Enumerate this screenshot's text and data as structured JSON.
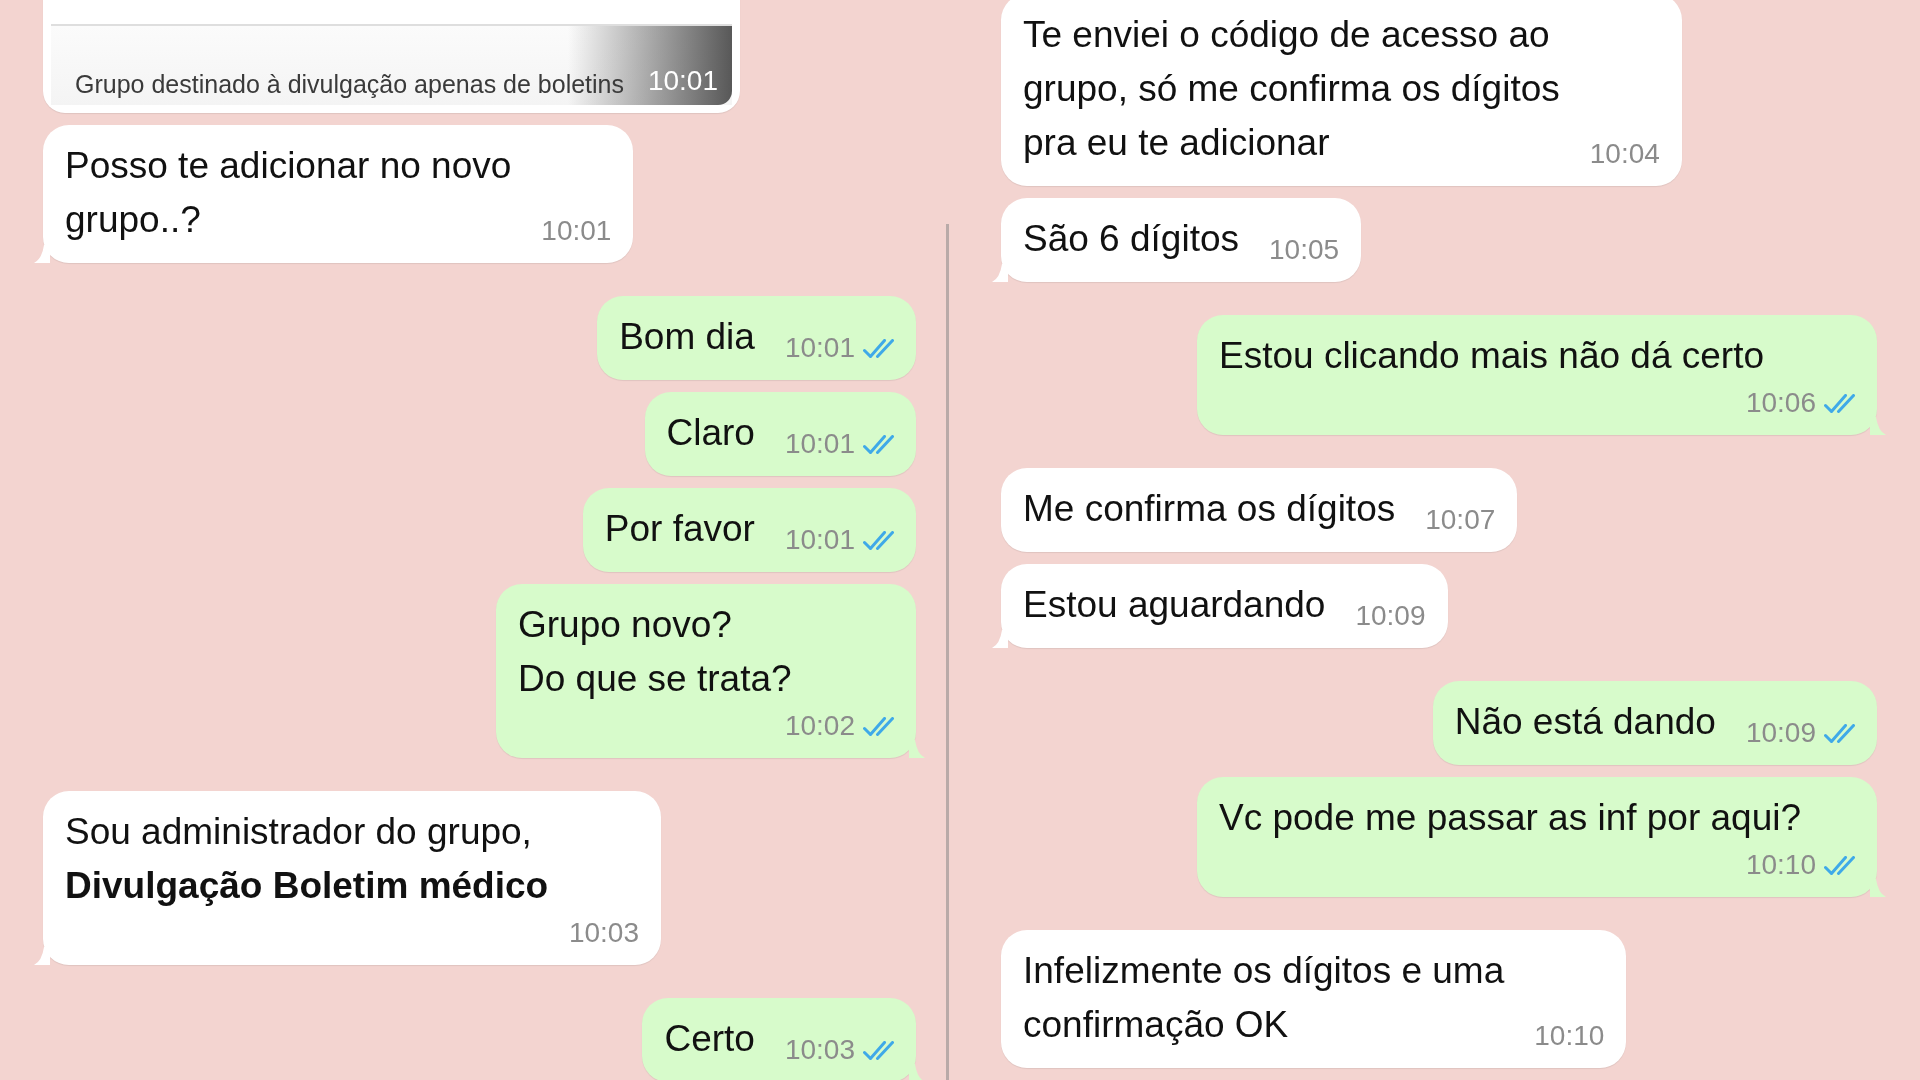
{
  "conversations": [
    {
      "messages": [
        {
          "kind": "link_preview",
          "outgoing": false,
          "caption": "Grupo destinado à divulgação apenas de boletins",
          "time": "10:01",
          "tail": false
        },
        {
          "kind": "text",
          "outgoing": false,
          "text": "Posso te adicionar no novo\ngrupo..?",
          "time": "10:01",
          "tail": true
        },
        {
          "kind": "text",
          "outgoing": true,
          "text": "Bom dia",
          "time": "10:01",
          "read": true,
          "tail": false
        },
        {
          "kind": "text",
          "outgoing": true,
          "text": "Claro",
          "time": "10:01",
          "read": true,
          "tail": false
        },
        {
          "kind": "text",
          "outgoing": true,
          "text": "Por favor",
          "time": "10:01",
          "read": true,
          "tail": false
        },
        {
          "kind": "text",
          "outgoing": true,
          "text": "Grupo novo?\nDo que se trata?",
          "time": "10:02",
          "read": true,
          "tail": true
        },
        {
          "kind": "text",
          "outgoing": false,
          "text": "Sou administrador do grupo,\n**Divulgação Boletim médico**",
          "time": "10:03",
          "tail": true
        },
        {
          "kind": "text",
          "outgoing": true,
          "text": "Certo",
          "time": "10:03",
          "read": true,
          "tail": true
        }
      ]
    },
    {
      "messages": [
        {
          "kind": "text",
          "outgoing": false,
          "text": "Te enviei o código de acesso ao\ngrupo, só me confirma os dígitos\npra eu te adicionar",
          "time": "10:04",
          "tail": false
        },
        {
          "kind": "text",
          "outgoing": false,
          "text": "São 6 dígitos",
          "time": "10:05",
          "tail": true
        },
        {
          "kind": "text",
          "outgoing": true,
          "text": "Estou clicando mais não dá certo",
          "time": "10:06",
          "read": true,
          "tail": true
        },
        {
          "kind": "text",
          "outgoing": false,
          "text": "Me confirma os dígitos",
          "time": "10:07",
          "tail": false
        },
        {
          "kind": "text",
          "outgoing": false,
          "text": "Estou aguardando",
          "time": "10:09",
          "tail": true
        },
        {
          "kind": "text",
          "outgoing": true,
          "text": "Não está dando",
          "time": "10:09",
          "read": true,
          "tail": false
        },
        {
          "kind": "text",
          "outgoing": true,
          "text": "Vc pode me passar as inf por aqui?",
          "time": "10:10",
          "read": true,
          "tail": true
        },
        {
          "kind": "text",
          "outgoing": false,
          "text": "Infelizmente os dígitos e uma\nconfirmação OK",
          "time": "10:10",
          "tail": false
        }
      ]
    }
  ]
}
